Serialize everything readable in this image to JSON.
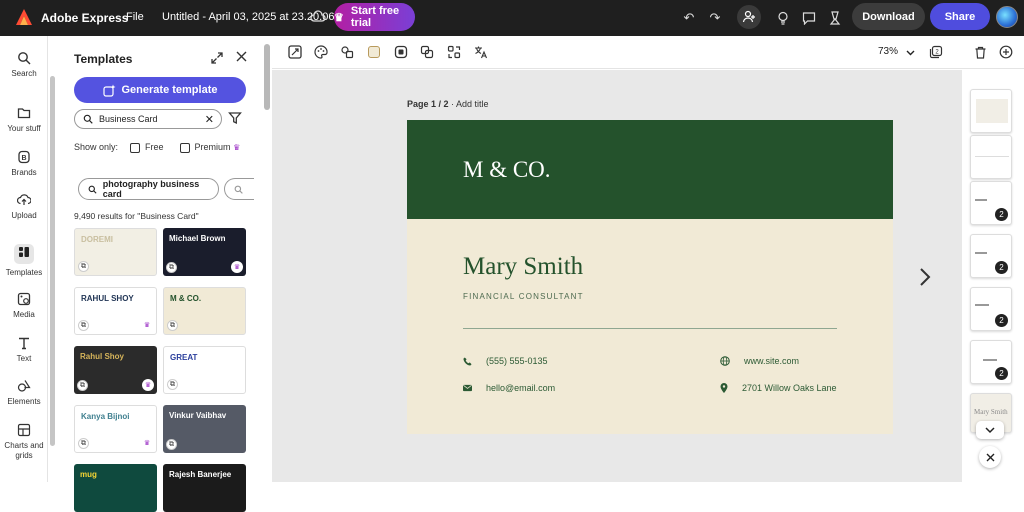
{
  "topbar": {
    "app_name": "Adobe Express",
    "file_menu": "File",
    "doc_title": "Untitled - April 03, 2025 at 23.20.06",
    "trial_label": "Start free trial",
    "download_label": "Download",
    "share_label": "Share"
  },
  "rail": {
    "items": [
      {
        "label": "Search",
        "icon": "search-icon"
      },
      {
        "label": "Your stuff",
        "icon": "folder-icon"
      },
      {
        "label": "Brands",
        "icon": "brand-icon"
      },
      {
        "label": "Upload",
        "icon": "upload-icon"
      },
      {
        "label": "Templates",
        "icon": "templates-icon"
      },
      {
        "label": "Media",
        "icon": "media-icon"
      },
      {
        "label": "Text",
        "icon": "text-icon"
      },
      {
        "label": "Elements",
        "icon": "elements-icon"
      },
      {
        "label": "Charts and grids",
        "icon": "charts-icon"
      }
    ]
  },
  "panel": {
    "title": "Templates",
    "generate_label": "Generate template",
    "search_value": "Business Card",
    "show_only_label": "Show only:",
    "free_label": "Free",
    "premium_label": "Premium",
    "chip_1": "photography business card",
    "results_text": "9,490 results for \"Business Card\"",
    "thumbs": [
      {
        "title": "DOREMI",
        "bg": "#f2efe4",
        "fg": "#c9bfa0"
      },
      {
        "title": "Michael Brown",
        "bg": "#1a1d2c",
        "fg": "#ffffff"
      },
      {
        "title": "RAHUL SHOY",
        "bg": "#ffffff",
        "fg": "#223656"
      },
      {
        "title": "M & CO.",
        "bg": "#f1ead6",
        "fg": "#24522c"
      },
      {
        "title": "Rahul Shoy",
        "bg": "#2b2b2b",
        "fg": "#d6b45a"
      },
      {
        "title": "GREAT",
        "bg": "#ffffff",
        "fg": "#2a3e9c"
      },
      {
        "title": "Kanya Bijnoi",
        "bg": "#ffffff",
        "fg": "#3f7f8f"
      },
      {
        "title": "Vinkur Vaibhav",
        "bg": "#555a66",
        "fg": "#ffffff"
      },
      {
        "title": "mug",
        "bg": "#0f4a3e",
        "fg": "#f6d533"
      },
      {
        "title": "Rajesh Banerjee",
        "bg": "#1b1b1b",
        "fg": "#ffffff"
      }
    ]
  },
  "toolbar": {
    "zoom": "73%"
  },
  "canvas": {
    "page_indicator": "Page 1 / 2",
    "add_title": "Add title",
    "card": {
      "logo": "M & CO.",
      "name": "Mary Smith",
      "role": "FINANCIAL CONSULTANT",
      "phone": "(555) 555-0135",
      "email": "hello@email.com",
      "website": "www.site.com",
      "address": "2701 Willow Oaks Lane"
    }
  },
  "pages_rail": {
    "counts": [
      "2",
      "2",
      "2",
      "2"
    ],
    "last_thumb_text": "Mary Smith"
  }
}
